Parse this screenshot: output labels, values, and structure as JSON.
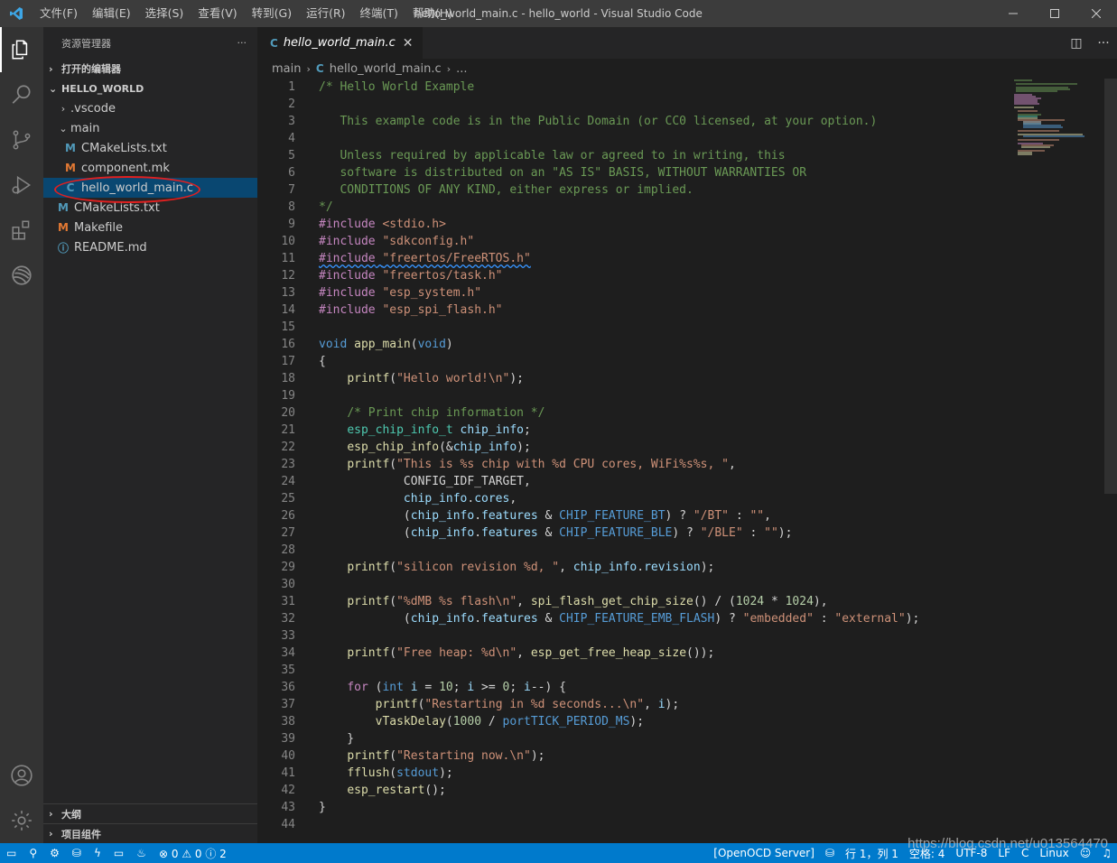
{
  "titlebar": {
    "menu": [
      "文件(F)",
      "编辑(E)",
      "选择(S)",
      "查看(V)",
      "转到(G)",
      "运行(R)",
      "终端(T)",
      "帮助(H)"
    ],
    "title": "hello_world_main.c - hello_world - Visual Studio Code"
  },
  "activitybar": {
    "items": [
      "explorer-icon",
      "search-icon",
      "source-control-icon",
      "run-debug-icon",
      "extensions-icon",
      "remote-icon"
    ],
    "bottom": [
      "account-icon",
      "gear-icon"
    ]
  },
  "sidebar": {
    "title": "资源管理器",
    "more": "···",
    "open_editors": "打开的编辑器",
    "project": "HELLO_WORLD",
    "tree": [
      {
        "label": ".vscode",
        "type": "folder",
        "icon": ">"
      },
      {
        "label": "main",
        "type": "folder-open",
        "icon": "v"
      },
      {
        "label": "CMakeLists.txt",
        "type": "cmake",
        "icon": "M"
      },
      {
        "label": "component.mk",
        "type": "make",
        "icon": "M"
      },
      {
        "label": "hello_world_main.c",
        "type": "c",
        "icon": "C"
      },
      {
        "label": "CMakeLists.txt",
        "type": "cmake",
        "icon": "M"
      },
      {
        "label": "Makefile",
        "type": "make",
        "icon": "M"
      },
      {
        "label": "README.md",
        "type": "info",
        "icon": "ⓘ"
      }
    ],
    "outline": "大纲",
    "project_components": "项目组件"
  },
  "editor": {
    "tab_label": "hello_world_main.c",
    "tab_icon": "C",
    "breadcrumb": [
      "main",
      "hello_world_main.c",
      "..."
    ],
    "lines": [
      "1",
      "2",
      "3",
      "4",
      "5",
      "6",
      "7",
      "8",
      "9",
      "10",
      "11",
      "12",
      "13",
      "14",
      "15",
      "16",
      "17",
      "18",
      "19",
      "20",
      "21",
      "22",
      "23",
      "24",
      "25",
      "26",
      "27",
      "28",
      "29",
      "30",
      "31",
      "32",
      "33",
      "34",
      "35",
      "36",
      "37",
      "38",
      "39",
      "40",
      "41",
      "42",
      "43",
      "44"
    ]
  },
  "statusbar": {
    "problems": "⊗ 0 ⚠ 0 ⓘ 2",
    "openocd": "[OpenOCD Server]",
    "position": "行 1，列 1",
    "spaces": "空格: 4",
    "encoding": "UTF-8",
    "eol": "LF",
    "language": "C",
    "platform": "Linux"
  },
  "watermark": "https://blog.csdn.net/u013564470",
  "colors": {
    "accent": "#007acc",
    "selection": "#094771",
    "annotation_circle": "#e02020"
  }
}
